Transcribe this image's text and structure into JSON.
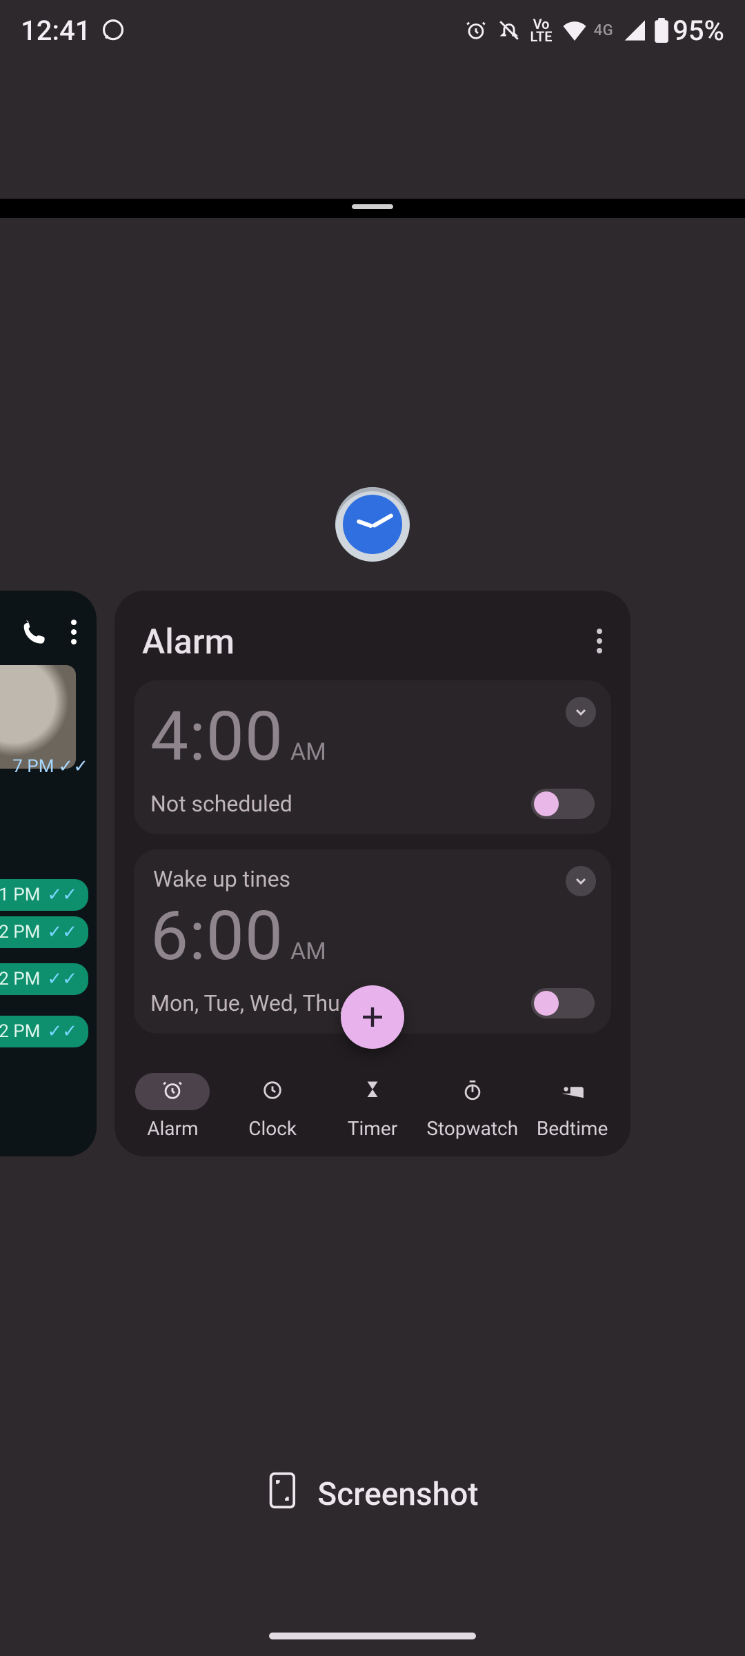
{
  "status": {
    "time": "12:41",
    "volte_top": "Vo",
    "volte_bot": "LTE",
    "net_label": "4G",
    "battery": "95%"
  },
  "prev_app": {
    "stamp": "7 PM",
    "bubbles": [
      "1 PM",
      "2 PM",
      "2 PM",
      "2 PM"
    ]
  },
  "clock": {
    "title": "Alarm",
    "alarms": [
      {
        "label": "",
        "time": "4:00",
        "ampm": "AM",
        "status": "Not scheduled"
      },
      {
        "label": "Wake up tines",
        "time": "6:00",
        "ampm": "AM",
        "status": "Mon, Tue, Wed, Thu, Fri"
      }
    ],
    "tabs": [
      "Alarm",
      "Clock",
      "Timer",
      "Stopwatch",
      "Bedtime"
    ]
  },
  "screenshot_label": "Screenshot"
}
